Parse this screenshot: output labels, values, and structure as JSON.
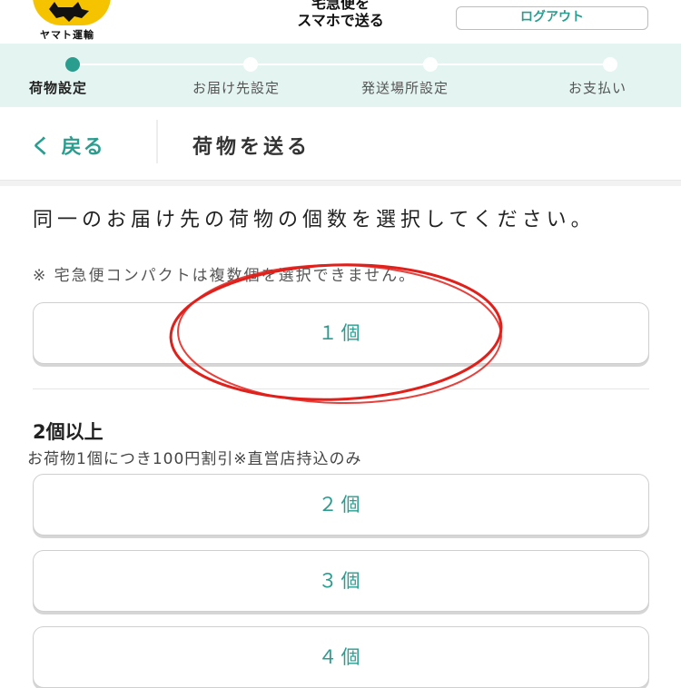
{
  "header": {
    "logo_text": "ヤマト運輸",
    "service_title_line1": "宅急便を",
    "service_title_line2": "スマホで送る",
    "logout_label": "ログアウト"
  },
  "stepper": {
    "steps": [
      {
        "label": "荷物設定",
        "active": true
      },
      {
        "label": "お届け先設定",
        "active": false
      },
      {
        "label": "発送場所設定",
        "active": false
      },
      {
        "label": "お支払い",
        "active": false
      }
    ]
  },
  "nav": {
    "back_label": "く 戻る",
    "page_title": "荷物を送る"
  },
  "content": {
    "question": "同一のお届け先の荷物の個数を選択してください。",
    "note": "※ 宅急便コンパクトは複数個を選択できません。",
    "single_option": "１個",
    "multi_heading": "2個以上",
    "multi_note": "お荷物1個につき100円割引※直営店持込のみ",
    "multi_options": [
      "２個",
      "３個",
      "４個"
    ]
  },
  "colors": {
    "accent": "#2a9d8f",
    "stepper_bg": "#e4f5f1",
    "logo_yellow": "#f6c300",
    "annotation_red": "#e0201b"
  }
}
